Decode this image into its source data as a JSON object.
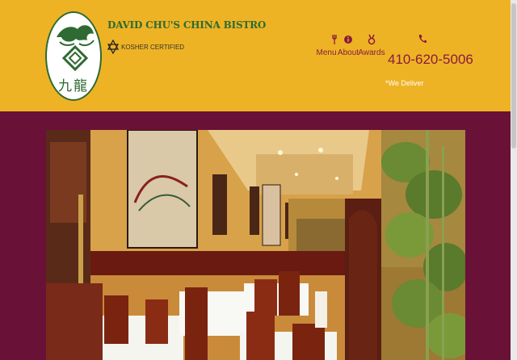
{
  "brand": {
    "name": "DAVID CHU'S CHINA BISTRO",
    "certification": "KOSHER CERTIFIED",
    "logo_text": "九龍"
  },
  "nav": {
    "items": [
      {
        "label": "Menu",
        "icon": "utensils-icon"
      },
      {
        "label": "About",
        "icon": "info-icon"
      },
      {
        "label": "Awards",
        "icon": "award-icon"
      }
    ]
  },
  "contact": {
    "phone": "410-620-5006",
    "delivery": "*We Deliver",
    "icon": "phone-icon"
  },
  "hero": {
    "alt": "Restaurant dining room interior"
  },
  "colors": {
    "header_bg": "#eeb324",
    "page_bg": "#6a1138",
    "brand_green": "#2f6a32",
    "nav_maroon": "#8a1b3e"
  }
}
